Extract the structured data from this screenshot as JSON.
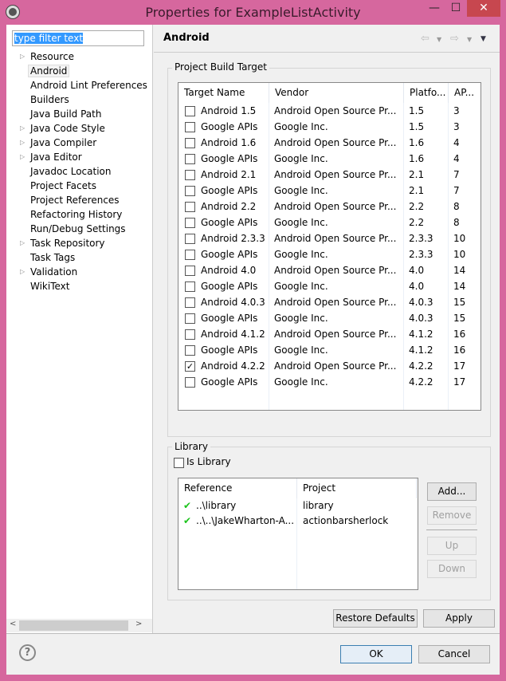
{
  "window": {
    "title": "Properties for ExampleListActivity",
    "minimize": "—",
    "maximize": "☐",
    "close": "✕"
  },
  "sidebar": {
    "filter_value": "type filter text",
    "items": [
      {
        "label": "Resource",
        "expandable": true
      },
      {
        "label": "Android",
        "expandable": false,
        "selected": true
      },
      {
        "label": "Android Lint Preferences",
        "expandable": false
      },
      {
        "label": "Builders",
        "expandable": false
      },
      {
        "label": "Java Build Path",
        "expandable": false
      },
      {
        "label": "Java Code Style",
        "expandable": true
      },
      {
        "label": "Java Compiler",
        "expandable": true
      },
      {
        "label": "Java Editor",
        "expandable": true
      },
      {
        "label": "Javadoc Location",
        "expandable": false
      },
      {
        "label": "Project Facets",
        "expandable": false
      },
      {
        "label": "Project References",
        "expandable": false
      },
      {
        "label": "Refactoring History",
        "expandable": false
      },
      {
        "label": "Run/Debug Settings",
        "expandable": false
      },
      {
        "label": "Task Repository",
        "expandable": true
      },
      {
        "label": "Task Tags",
        "expandable": false
      },
      {
        "label": "Validation",
        "expandable": true
      },
      {
        "label": "WikiText",
        "expandable": false
      }
    ]
  },
  "page": {
    "title": "Android",
    "build_target": {
      "label": "Project Build Target",
      "columns": [
        "Target Name",
        "Vendor",
        "Platfo...",
        "AP..."
      ],
      "rows": [
        {
          "name": "Android 1.5",
          "vendor": "Android Open Source Pr...",
          "platform": "1.5",
          "api": "3",
          "checked": false
        },
        {
          "name": "Google APIs",
          "vendor": "Google Inc.",
          "platform": "1.5",
          "api": "3",
          "checked": false
        },
        {
          "name": "Android 1.6",
          "vendor": "Android Open Source Pr...",
          "platform": "1.6",
          "api": "4",
          "checked": false
        },
        {
          "name": "Google APIs",
          "vendor": "Google Inc.",
          "platform": "1.6",
          "api": "4",
          "checked": false
        },
        {
          "name": "Android 2.1",
          "vendor": "Android Open Source Pr...",
          "platform": "2.1",
          "api": "7",
          "checked": false
        },
        {
          "name": "Google APIs",
          "vendor": "Google Inc.",
          "platform": "2.1",
          "api": "7",
          "checked": false
        },
        {
          "name": "Android 2.2",
          "vendor": "Android Open Source Pr...",
          "platform": "2.2",
          "api": "8",
          "checked": false
        },
        {
          "name": "Google APIs",
          "vendor": "Google Inc.",
          "platform": "2.2",
          "api": "8",
          "checked": false
        },
        {
          "name": "Android 2.3.3",
          "vendor": "Android Open Source Pr...",
          "platform": "2.3.3",
          "api": "10",
          "checked": false
        },
        {
          "name": "Google APIs",
          "vendor": "Google Inc.",
          "platform": "2.3.3",
          "api": "10",
          "checked": false
        },
        {
          "name": "Android 4.0",
          "vendor": "Android Open Source Pr...",
          "platform": "4.0",
          "api": "14",
          "checked": false
        },
        {
          "name": "Google APIs",
          "vendor": "Google Inc.",
          "platform": "4.0",
          "api": "14",
          "checked": false
        },
        {
          "name": "Android 4.0.3",
          "vendor": "Android Open Source Pr...",
          "platform": "4.0.3",
          "api": "15",
          "checked": false
        },
        {
          "name": "Google APIs",
          "vendor": "Google Inc.",
          "platform": "4.0.3",
          "api": "15",
          "checked": false
        },
        {
          "name": "Android 4.1.2",
          "vendor": "Android Open Source Pr...",
          "platform": "4.1.2",
          "api": "16",
          "checked": false
        },
        {
          "name": "Google APIs",
          "vendor": "Google Inc.",
          "platform": "4.1.2",
          "api": "16",
          "checked": false
        },
        {
          "name": "Android 4.2.2",
          "vendor": "Android Open Source Pr...",
          "platform": "4.2.2",
          "api": "17",
          "checked": true
        },
        {
          "name": "Google APIs",
          "vendor": "Google Inc.",
          "platform": "4.2.2",
          "api": "17",
          "checked": false
        }
      ]
    },
    "library": {
      "label": "Library",
      "is_library_label": "Is Library",
      "is_library": false,
      "columns": [
        "Reference",
        "Project"
      ],
      "rows": [
        {
          "reference": "..\\library",
          "project": "library"
        },
        {
          "reference": "..\\..\\JakeWharton-A...",
          "project": "actionbarsherlock"
        }
      ],
      "buttons": {
        "add": "Add...",
        "remove": "Remove",
        "up": "Up",
        "down": "Down"
      }
    },
    "restore_defaults": "Restore Defaults",
    "apply": "Apply"
  },
  "footer": {
    "ok": "OK",
    "cancel": "Cancel",
    "help": "?"
  }
}
